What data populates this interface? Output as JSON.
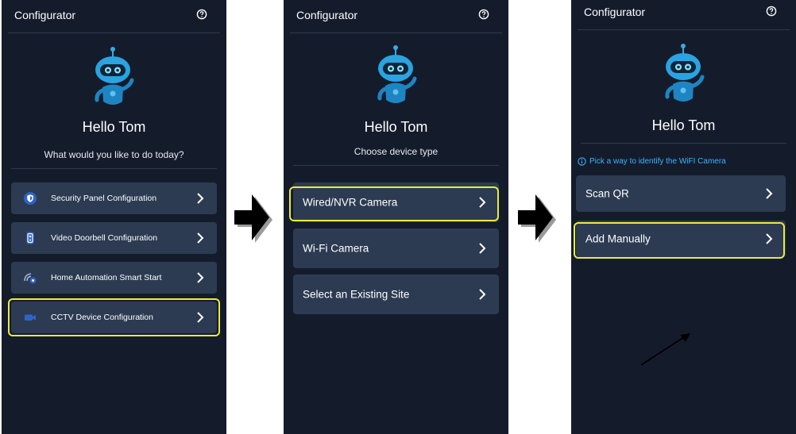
{
  "screens": [
    {
      "header": {
        "title": "Configurator",
        "help_icon": "help-circle-icon"
      },
      "greeting": "Hello Tom",
      "prompt": "What would you like to do today?",
      "menu": [
        {
          "label": "Security Panel Configuration",
          "icon": "shield-icon",
          "selected": false
        },
        {
          "label": "Video Doorbell Configuration",
          "icon": "doorbell-icon",
          "selected": false
        },
        {
          "label": "Home Automation Smart Start",
          "icon": "wifi-gear-icon",
          "selected": false
        },
        {
          "label": "CCTV Device Configuration",
          "icon": "camera-icon",
          "selected": true
        }
      ]
    },
    {
      "header": {
        "title": "Configurator",
        "help_icon": "help-circle-icon"
      },
      "greeting": "Hello Tom",
      "prompt": "Choose device type",
      "menu": [
        {
          "label": "Wired/NVR Camera",
          "selected": true
        },
        {
          "label": "Wi-Fi Camera",
          "selected": false
        },
        {
          "label": "Select an Existing Site",
          "selected": false
        }
      ]
    },
    {
      "header": {
        "title": "Configurator",
        "help_icon": "help-circle-icon"
      },
      "greeting": "Hello Tom",
      "info": "Pick a way to identify the WiFI Camera",
      "menu": [
        {
          "label": "Scan QR",
          "selected": false
        },
        {
          "label": "Add Manually",
          "selected": true
        }
      ]
    }
  ],
  "colors": {
    "background": "#141c2c",
    "card": "#2c3b52",
    "highlight": "#ecea3c",
    "info": "#3fb2ff",
    "robot": "#2aa3e0"
  }
}
